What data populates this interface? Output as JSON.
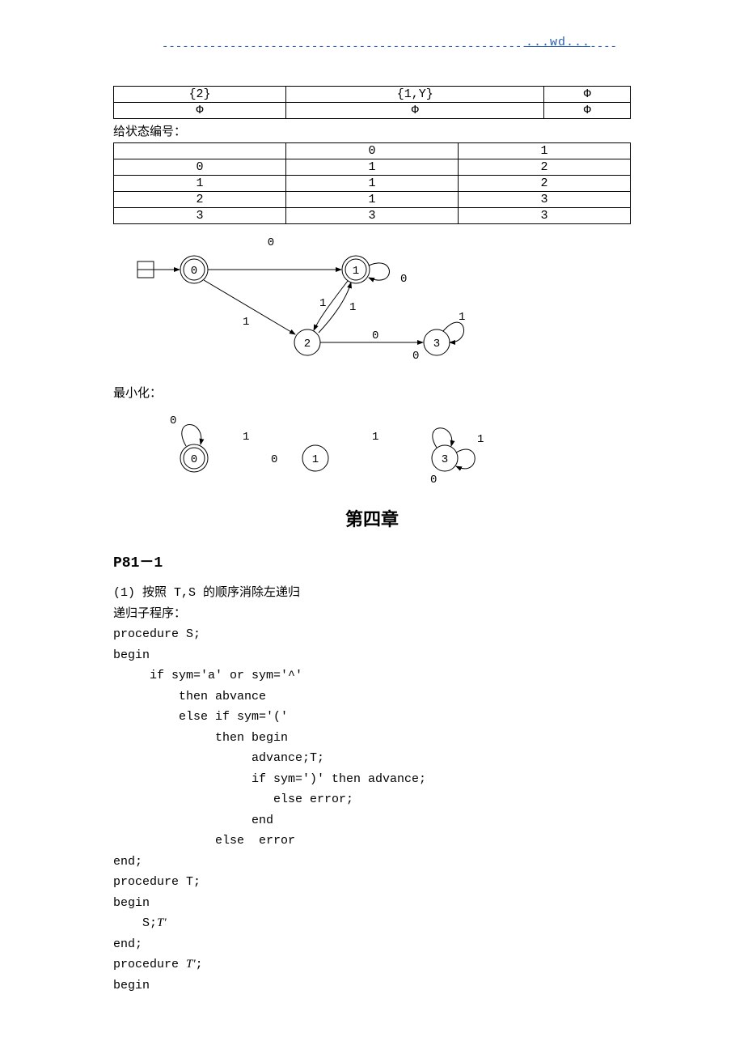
{
  "header": {
    "wd": "...wd...",
    "dashes": "-------------------------------------------------------------------"
  },
  "table1": {
    "rows": [
      [
        "{2}",
        "{1,Y}",
        "Φ"
      ],
      [
        "Φ",
        "Φ",
        "Φ"
      ]
    ]
  },
  "label_state_num": "给状态编号：",
  "table2": {
    "rows": [
      [
        "",
        "0",
        "1"
      ],
      [
        "0",
        "1",
        "2"
      ],
      [
        "1",
        "1",
        "2"
      ],
      [
        "2",
        "1",
        "3"
      ],
      [
        "3",
        "3",
        "3"
      ]
    ]
  },
  "label_minimize": "最小化：",
  "diagram1": {
    "nodes": [
      "0",
      "1",
      "2",
      "3"
    ],
    "edge_labels": [
      "0",
      "0",
      "1",
      "1",
      "1",
      "0",
      "0",
      "1"
    ]
  },
  "diagram2": {
    "nodes": [
      "0",
      "1",
      "3"
    ],
    "edge_labels": [
      "0",
      "1",
      "0",
      "1",
      "0",
      "1"
    ]
  },
  "chapter_title": "第四章",
  "section_head": "P81－1",
  "code": {
    "l1": "(1) 按照 T,S 的顺序消除左递归",
    "l2": "递归子程序：",
    "l3": "procedure S;",
    "l4": "begin",
    "l5": "     if sym='a' or sym='^'",
    "l6": "         then abvance",
    "l7": "         else if sym='('",
    "l8": "              then begin",
    "l9": "                   advance;T;",
    "l10": "                   if sym=')' then advance;",
    "l11": "                      else error;",
    "l12": "                   end",
    "l13": "              else  error",
    "l14": "end;",
    "l15": "procedure T;",
    "l16": "begin",
    "l17a": "    S;",
    "l17b": "T′",
    "l18": "end;",
    "l19a": "procedure ",
    "l19b": "T′",
    "l19c": ";",
    "l20": "begin"
  }
}
